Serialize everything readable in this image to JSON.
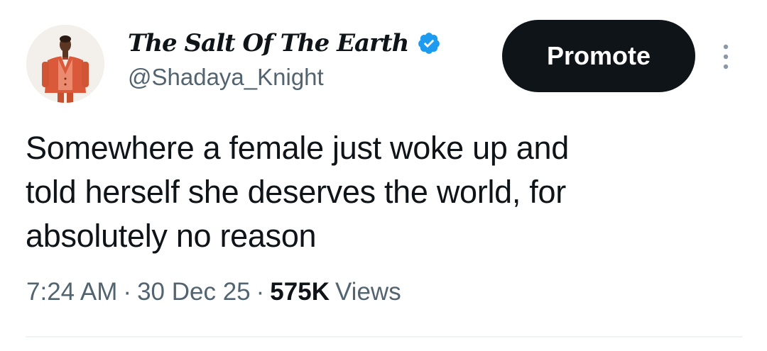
{
  "author": {
    "display_name": "The Salt Of The Earth",
    "handle": "@Shadaya_Knight",
    "verified": true,
    "verified_color": "#1d9bf0"
  },
  "actions": {
    "promote_label": "Promote",
    "more_icon": "more-vertical-icon"
  },
  "tweet": {
    "text": "Somewhere a female just woke up and\ntold herself she deserves the world, for\nabsolutely no reason"
  },
  "meta": {
    "time": "7:24 AM",
    "date": "30 Dec 25",
    "separator": "·",
    "views_count": "575K",
    "views_label": "Views"
  },
  "colors": {
    "text_primary": "#0f1419",
    "text_secondary": "#536471",
    "button_bg": "#0f1419",
    "divider": "#eff3f4"
  }
}
